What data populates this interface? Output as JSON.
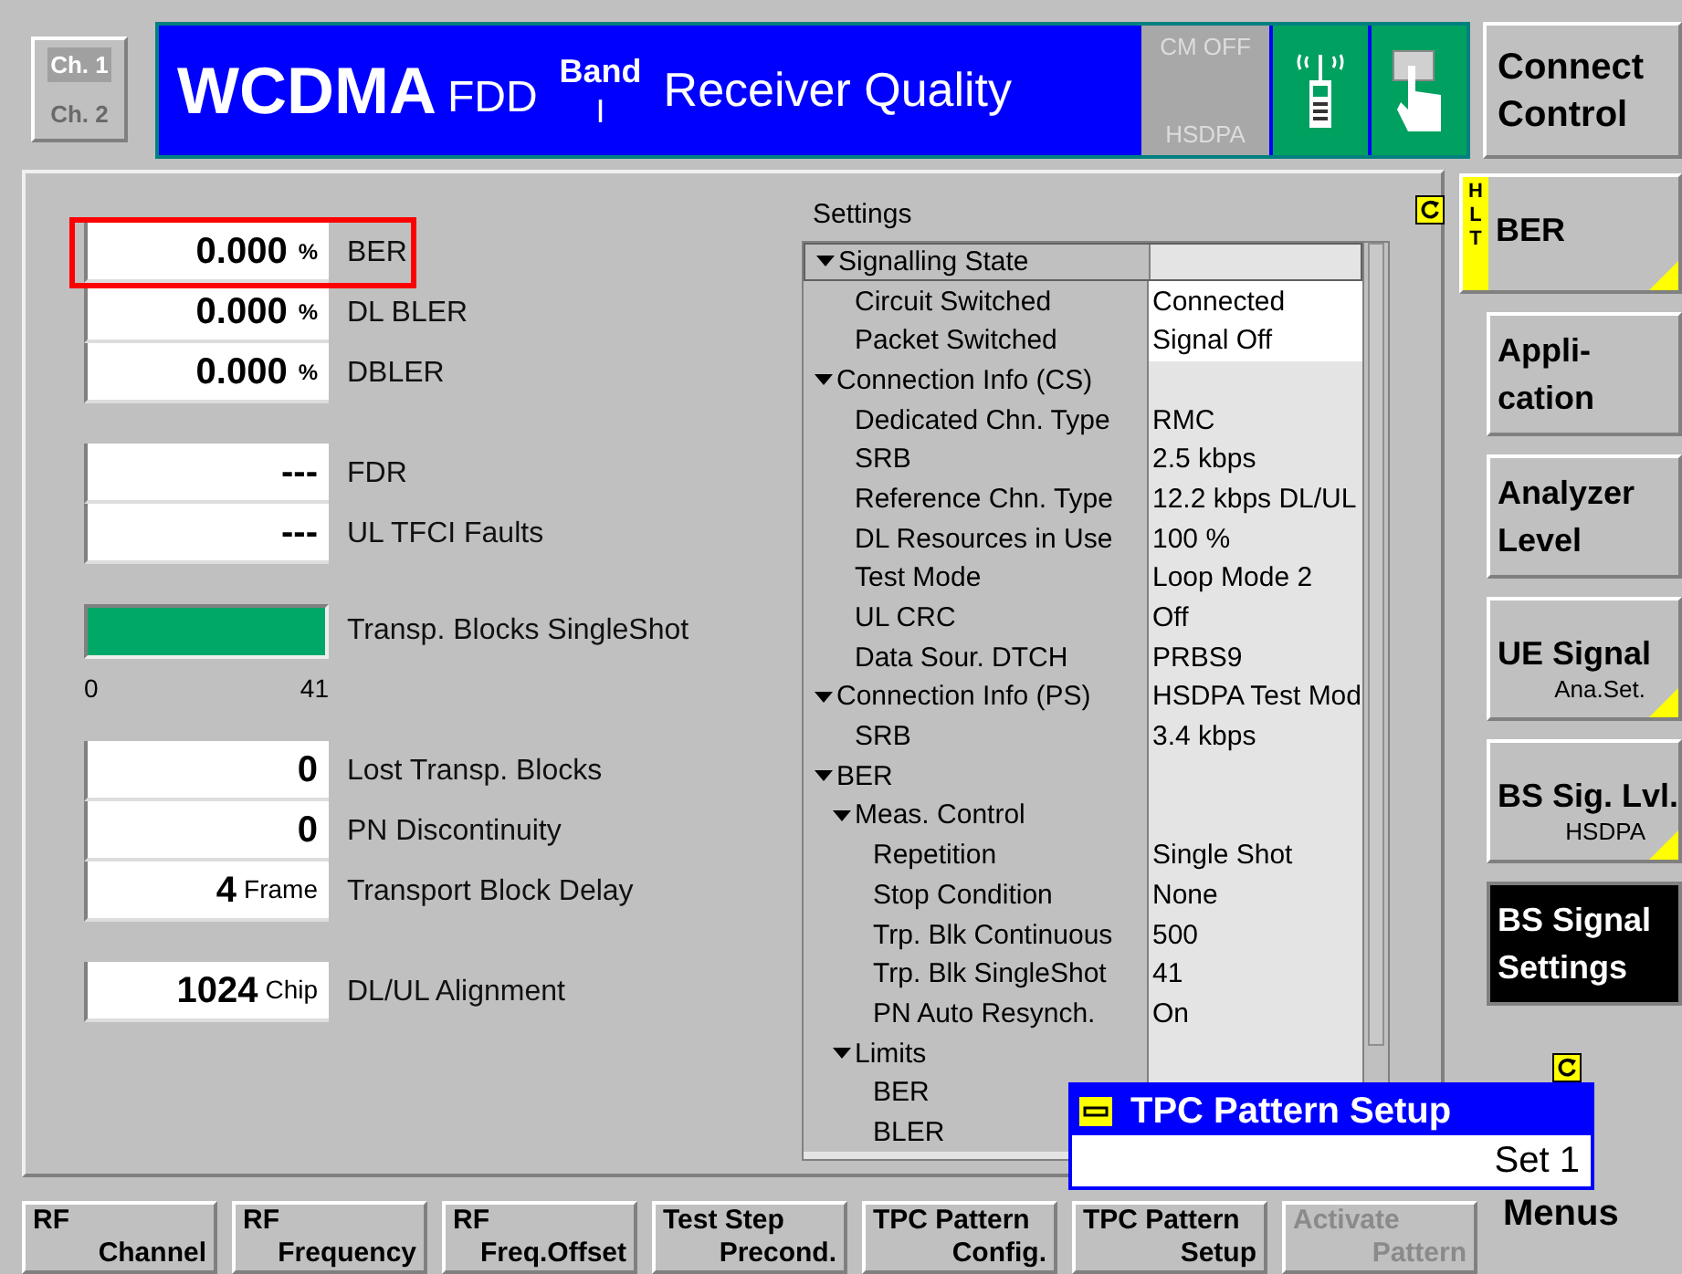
{
  "header": {
    "channels": [
      {
        "label": "Ch. 1",
        "selected": true
      },
      {
        "label": "Ch. 2",
        "selected": false
      }
    ],
    "title": "WCDMA",
    "standard": "FDD",
    "band_label": "Band",
    "band": "I",
    "application": "Receiver Quality",
    "status": [
      "CM OFF",
      "HSDPA"
    ]
  },
  "connect_control": {
    "label": "Connect Control"
  },
  "results": [
    [
      {
        "value": "0.000",
        "unit": "%",
        "label": "BER",
        "highlighted": true
      },
      {
        "value": "0.000",
        "unit": "%",
        "label": "DL BLER",
        "highlighted": false
      },
      {
        "value": "0.000",
        "unit": "%",
        "label": "DBLER",
        "highlighted": false
      }
    ],
    [
      {
        "value": "---",
        "label": "FDR",
        "highlighted": false
      },
      {
        "value": "---",
        "label": "UL TFCI Faults",
        "highlighted": false
      }
    ],
    [
      {
        "kind": "bar",
        "level": 1,
        "label": "Transp. Blocks SingleShot",
        "scale_min": "0",
        "scale_max": "41"
      }
    ],
    [
      {
        "value": "0",
        "label": "Lost Transp. Blocks",
        "highlighted": false
      },
      {
        "value": "0",
        "label": "PN Discontinuity",
        "highlighted": false
      },
      {
        "value": "4",
        "unit": "Frame",
        "label": "Transport Block Delay",
        "highlighted": false
      }
    ],
    [
      {
        "value": "1024",
        "unit": "Chip",
        "label": "DL/UL Alignment",
        "highlighted": false
      }
    ]
  ],
  "settings": {
    "title": "Settings",
    "rows": [
      {
        "name": "Signalling State",
        "selected": true,
        "expanded": true,
        "children": [
          {
            "name": "Circuit Switched",
            "value": "Connected"
          },
          {
            "name": "Packet Switched",
            "value": "Signal Off"
          }
        ]
      },
      {
        "name": "Connection Info (CS)",
        "selected": false,
        "expanded": true,
        "children": [
          {
            "name": "Dedicated Chn. Type",
            "value": "RMC"
          },
          {
            "name": "SRB",
            "value": "2.5 kbps"
          },
          {
            "name": "Reference Chn. Type",
            "value": "12.2 kbps DL/UL"
          },
          {
            "name": "DL Resources in Use",
            "value": "100 %"
          },
          {
            "name": "Test Mode",
            "value": "Loop Mode 2"
          },
          {
            "name": "UL CRC",
            "value": "Off"
          },
          {
            "name": "Data Sour. DTCH",
            "value": "PRBS9"
          }
        ]
      },
      {
        "name": "Connection Info (PS)",
        "value": "HSDPA Test Mod",
        "selected": false,
        "expanded": true,
        "children": [
          {
            "name": "SRB",
            "value": "3.4 kbps"
          }
        ]
      },
      {
        "name": "BER",
        "selected": false,
        "expanded": true,
        "children": [
          {
            "name": "Meas. Control",
            "expanded": true,
            "children": [
              {
                "name": "Repetition",
                "value": "Single Shot"
              },
              {
                "name": "Stop Condition",
                "value": "None"
              },
              {
                "name": "Trp. Blk Continuous",
                "value": "500"
              },
              {
                "name": "Trp. Blk SingleShot",
                "value": "41"
              },
              {
                "name": "PN Auto Resynch.",
                "value": "On"
              }
            ]
          },
          {
            "name": "Limits",
            "expanded": true,
            "children": [
              {
                "name": "BER"
              },
              {
                "name": "BLER"
              }
            ]
          }
        ]
      }
    ]
  },
  "popup": {
    "title": "TPC Pattern Setup",
    "value": "Set 1"
  },
  "side_keys": [
    {
      "label": "BER",
      "tag": "HLT",
      "selected": false,
      "has_menu": true
    },
    {
      "label": "Appli-\ncation",
      "selected": false,
      "has_menu": false
    },
    {
      "label": "Analyzer\nLevel",
      "selected": false,
      "has_menu": false
    },
    {
      "label": "UE Signal",
      "sublabel": "Ana.Set.",
      "selected": false,
      "has_menu": true
    },
    {
      "label": "BS Sig. Lvl.",
      "sublabel": "HSDPA",
      "selected": false,
      "has_menu": true
    },
    {
      "label": "BS Signal\nSettings",
      "selected": true,
      "has_menu": false
    }
  ],
  "menus_label": "Menus",
  "bottom_keys": [
    {
      "line1": "RF",
      "line2": "Channel",
      "disabled": false
    },
    {
      "line1": "RF",
      "line2": "Frequency",
      "disabled": false
    },
    {
      "line1": "RF",
      "line2": "Freq.Offset",
      "disabled": false
    },
    {
      "line1": "Test Step",
      "line2": "Precond.",
      "disabled": false
    },
    {
      "line1": "TPC Pattern",
      "line2": "Config.",
      "disabled": false
    },
    {
      "line1": "TPC Pattern",
      "line2": "Setup",
      "disabled": false
    },
    {
      "line1": "Activate",
      "line2": "Pattern",
      "disabled": true
    }
  ]
}
